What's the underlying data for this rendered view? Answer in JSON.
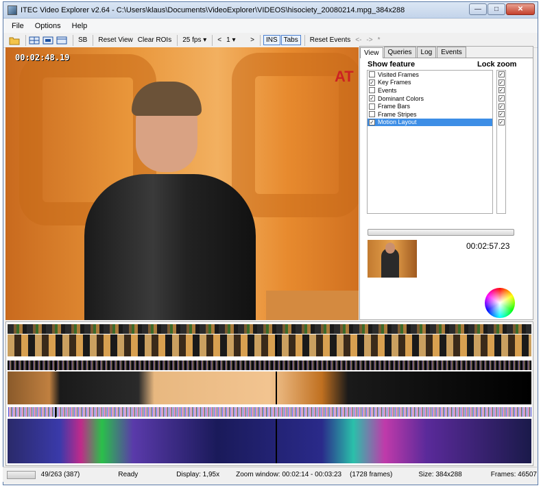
{
  "window": {
    "title": "ITEC Video Explorer v2.64 - C:\\Users\\klaus\\Documents\\VideoExplorer\\VIDEOS\\hisociety_20080214.mpg_384x288"
  },
  "menu": [
    "File",
    "Options",
    "Help"
  ],
  "toolbar": {
    "sb": "SB",
    "reset_view": "Reset View",
    "clear_rois": "Clear ROIs",
    "fps": "25 fps",
    "prev": "<",
    "step": "1",
    "next": ">",
    "ins": "INS",
    "tabs": "Tabs",
    "reset_events": "Reset Events",
    "back": "<-",
    "forward": "->",
    "star": "*"
  },
  "video": {
    "timecode": "00:02:48.19",
    "logo": "AT"
  },
  "panel": {
    "tabs": [
      "View",
      "Queries",
      "Log",
      "Events"
    ],
    "show_feature": "Show feature",
    "lock_zoom": "Lock zoom",
    "features": [
      {
        "label": "Visited Frames",
        "checked": false,
        "lock": true
      },
      {
        "label": "Key Frames",
        "checked": true,
        "lock": true
      },
      {
        "label": "Events",
        "checked": false,
        "lock": true
      },
      {
        "label": "Dominant Colors",
        "checked": true,
        "lock": true
      },
      {
        "label": "Frame Bars",
        "checked": false,
        "lock": true
      },
      {
        "label": "Frame Stripes",
        "checked": false,
        "lock": true
      },
      {
        "label": "Motion Layout",
        "checked": true,
        "lock": true,
        "selected": true
      }
    ],
    "timecode": "00:02:57.23"
  },
  "status": {
    "frames_visited": "49/263 (387)",
    "state": "Ready",
    "display": "Display: 1,95x",
    "zoom_window": "Zoom window: 00:02:14 - 00:03:23",
    "zoom_frames": "(1728 frames)",
    "size": "Size: 384x288",
    "frames": "Frames: 46507"
  }
}
